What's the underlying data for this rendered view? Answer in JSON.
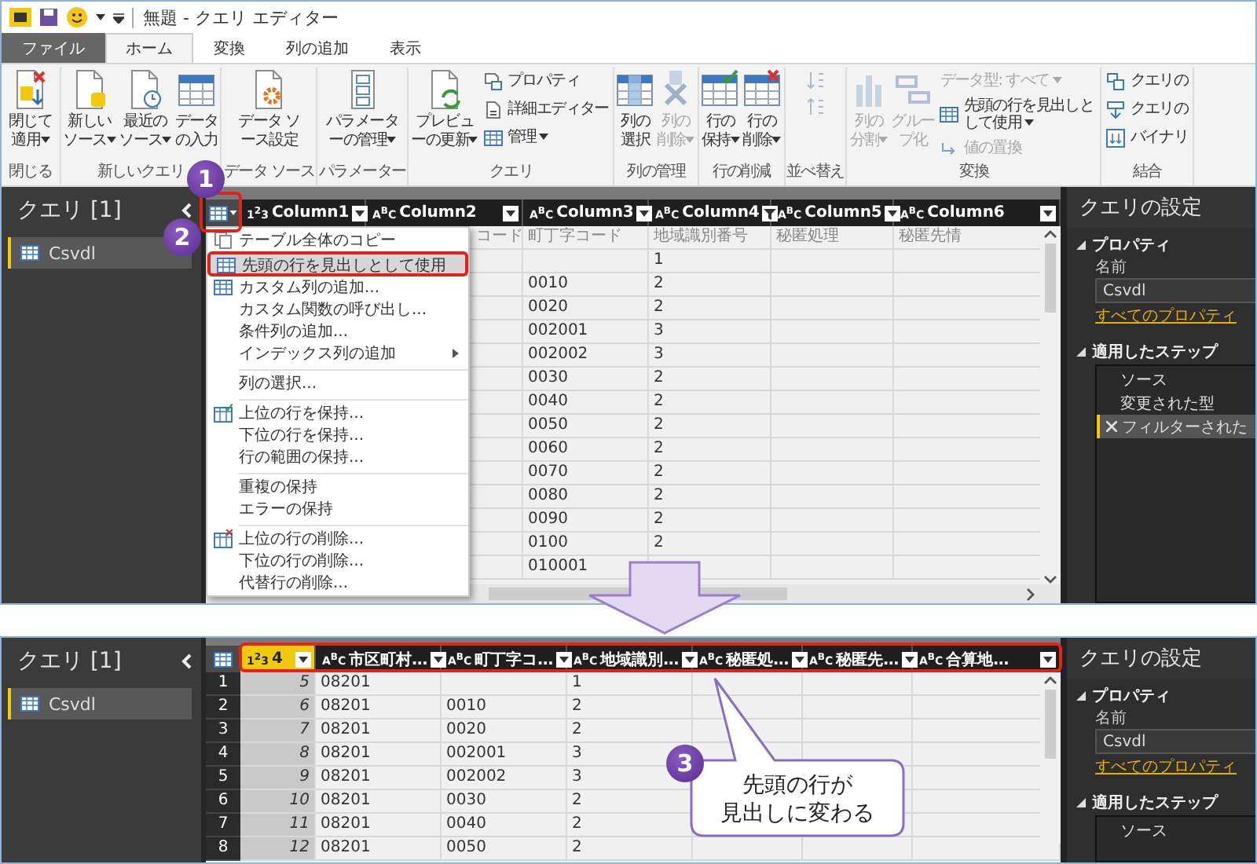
{
  "top_screenshot": {
    "title_bar": {
      "title": "無題 - クエリ エディター"
    },
    "tabs": [
      {
        "label": "ファイル",
        "kind": "file",
        "selected": false
      },
      {
        "label": "ホーム",
        "kind": "tab",
        "selected": true
      },
      {
        "label": "変換",
        "kind": "tab",
        "selected": false
      },
      {
        "label": "列の追加",
        "kind": "tab",
        "selected": false
      },
      {
        "label": "表示",
        "kind": "tab",
        "selected": false
      }
    ],
    "ribbon_groups": [
      {
        "label": "閉じる",
        "items": [
          {
            "kind": "large",
            "label": "閉じて適用",
            "dropdown": true,
            "disabled": false
          }
        ]
      },
      {
        "label": "新しいクエリ",
        "items": [
          {
            "kind": "large",
            "label": "新しいソース",
            "dropdown": true,
            "disabled": false
          },
          {
            "kind": "large",
            "label": "最近のソース",
            "dropdown": true,
            "disabled": false
          },
          {
            "kind": "large",
            "label": "データの入力",
            "dropdown": false,
            "disabled": false
          }
        ]
      },
      {
        "label": "データ ソース",
        "items": [
          {
            "kind": "large",
            "label": "データ ソース設定",
            "dropdown": false,
            "disabled": false
          }
        ]
      },
      {
        "label": "パラメーター",
        "items": [
          {
            "kind": "large",
            "label": "パラメーターの管理",
            "dropdown": true,
            "disabled": false
          }
        ]
      },
      {
        "label": "クエリ",
        "items": [
          {
            "kind": "large",
            "label": "プレビューの更新",
            "dropdown": true,
            "disabled": false
          },
          {
            "kind": "small",
            "label": "プロパティ",
            "dropdown": false,
            "disabled": false
          },
          {
            "kind": "small",
            "label": "詳細エディター",
            "dropdown": false,
            "disabled": false
          },
          {
            "kind": "small",
            "label": "管理",
            "dropdown": true,
            "disabled": false
          }
        ]
      },
      {
        "label": "列の管理",
        "items": [
          {
            "kind": "large",
            "label": "列の選択",
            "dropdown": false,
            "disabled": false
          },
          {
            "kind": "large",
            "label": "列の削除",
            "dropdown": true,
            "disabled": true
          }
        ]
      },
      {
        "label": "行の削減",
        "items": [
          {
            "kind": "large",
            "label": "行の保持",
            "dropdown": true,
            "disabled": false
          },
          {
            "kind": "large",
            "label": "行の削除",
            "dropdown": true,
            "disabled": false
          }
        ]
      },
      {
        "label": "並べ替え",
        "items": [
          {
            "kind": "icon",
            "disabled": true
          },
          {
            "kind": "icon",
            "disabled": true
          }
        ]
      },
      {
        "label": "変換",
        "items": [
          {
            "kind": "large",
            "label": "列の分割",
            "dropdown": true,
            "disabled": true
          },
          {
            "kind": "large",
            "label": "グループ化",
            "dropdown": false,
            "disabled": true
          },
          {
            "kind": "small",
            "label": "データ型: すべて",
            "dropdown": true,
            "disabled": true
          },
          {
            "kind": "small",
            "label": "先頭の行を見出しとして使用",
            "dropdown": true,
            "disabled": false
          },
          {
            "kind": "small",
            "label": "値の置換",
            "dropdown": false,
            "disabled": true
          }
        ]
      },
      {
        "label": "結合",
        "items": [
          {
            "kind": "small",
            "label": "クエリの",
            "dropdown": false,
            "disabled": false
          },
          {
            "kind": "small",
            "label": "クエリの",
            "dropdown": false,
            "disabled": false
          },
          {
            "kind": "small",
            "label": "バイナリ",
            "dropdown": false,
            "disabled": false
          }
        ]
      }
    ],
    "query_pane": {
      "title": "クエリ [1]",
      "items": [
        {
          "label": "Csvdl",
          "selected": true
        }
      ]
    },
    "grid": {
      "columns": [
        {
          "label": "Column1",
          "type": "1$^{2}$3",
          "filtered": false
        },
        {
          "label": "Column2",
          "type": "A$^{B}$C",
          "filtered": false
        },
        {
          "label": "Column3",
          "type": "A$^{B}$C",
          "filtered": false
        },
        {
          "label": "Column4",
          "type": "A$^{B}$C",
          "filtered": true
        },
        {
          "label": "Column5",
          "type": "A$^{B}$C",
          "filtered": false
        },
        {
          "label": "Column6",
          "type": "A$^{B}$C",
          "filtered": false
        }
      ],
      "rows": [
        {
          "kind": "header_text",
          "column_2": "コード",
          "column_3": "町丁字コード",
          "column_4": "地域識別番号",
          "column_5": "秘匿処理",
          "column_6": "秘匿先情"
        },
        {
          "kind": "data",
          "column_4": "1"
        },
        {
          "kind": "data",
          "column_3": "0010",
          "column_4": "2"
        },
        {
          "kind": "data",
          "column_3": "0020",
          "column_4": "2"
        },
        {
          "kind": "data",
          "column_3": "002001",
          "column_4": "3"
        },
        {
          "kind": "data",
          "column_3": "002002",
          "column_4": "3"
        },
        {
          "kind": "data",
          "column_3": "0030",
          "column_4": "2"
        },
        {
          "kind": "data",
          "column_3": "0040",
          "column_4": "2"
        },
        {
          "kind": "data",
          "column_3": "0050",
          "column_4": "2"
        },
        {
          "kind": "data",
          "column_3": "0060",
          "column_4": "2"
        },
        {
          "kind": "data",
          "column_3": "0070",
          "column_4": "2"
        },
        {
          "kind": "data",
          "column_3": "0080",
          "column_4": "2"
        },
        {
          "kind": "data",
          "column_3": "0090",
          "column_4": "2"
        },
        {
          "kind": "data",
          "column_3": "0100",
          "column_4": "2"
        },
        {
          "kind": "data",
          "column_3": "010001"
        }
      ]
    },
    "context_menu": {
      "items": [
        {
          "kind": "item",
          "label": "テーブル全体のコピー",
          "selected": false,
          "submenu": false
        },
        {
          "kind": "item",
          "label": "先頭の行を見出しとして使用",
          "selected": true,
          "submenu": false
        },
        {
          "kind": "item",
          "label": "カスタム列の追加...",
          "selected": false,
          "submenu": false
        },
        {
          "kind": "item",
          "label": "カスタム関数の呼び出し...",
          "selected": false,
          "submenu": false
        },
        {
          "kind": "item",
          "label": "条件列の追加...",
          "selected": false,
          "submenu": false
        },
        {
          "kind": "item",
          "label": "インデックス列の追加",
          "selected": false,
          "submenu": true
        },
        {
          "kind": "separator"
        },
        {
          "kind": "item",
          "label": "列の選択...",
          "selected": false,
          "submenu": false
        },
        {
          "kind": "separator"
        },
        {
          "kind": "item",
          "label": "上位の行を保持...",
          "selected": false,
          "submenu": false
        },
        {
          "kind": "item",
          "label": "下位の行を保持...",
          "selected": false,
          "submenu": false
        },
        {
          "kind": "item",
          "label": "行の範囲の保持...",
          "selected": false,
          "submenu": false
        },
        {
          "kind": "separator"
        },
        {
          "kind": "item",
          "label": "重複の保持",
          "selected": false,
          "submenu": false
        },
        {
          "kind": "item",
          "label": "エラーの保持",
          "selected": false,
          "submenu": false
        },
        {
          "kind": "separator"
        },
        {
          "kind": "item",
          "label": "上位の行の削除...",
          "selected": false,
          "submenu": false
        },
        {
          "kind": "item",
          "label": "下位の行の削除...",
          "selected": false,
          "submenu": false
        },
        {
          "kind": "item",
          "label": "代替行の削除...",
          "selected": false,
          "submenu": false
        }
      ]
    },
    "query_settings": {
      "title": "クエリの設定",
      "properties_heading": "プロパティ",
      "name_label": "名前",
      "name_value": "Csvdl",
      "all_properties_link": "すべてのプロパティ",
      "steps_heading": "適用したステップ",
      "steps": [
        {
          "label": "ソース",
          "selected": false
        },
        {
          "label": "変更された型",
          "selected": false
        },
        {
          "label": "フィルターされた",
          "selected": true
        }
      ]
    }
  },
  "bottom_screenshot": {
    "query_pane": {
      "title": "クエリ [1]",
      "items": [
        {
          "label": "Csvdl",
          "selected": true
        }
      ]
    },
    "grid": {
      "columns": [
        {
          "label": "4",
          "type": "1$^{2}$3",
          "selected": true
        },
        {
          "label": "市区町村…",
          "type": "A$^{B}$C",
          "selected": false
        },
        {
          "label": "町丁字コ…",
          "type": "A$^{B}$C",
          "selected": false
        },
        {
          "label": "地域識別…",
          "type": "A$^{B}$C",
          "selected": false
        },
        {
          "label": "秘匿処…",
          "type": "A$^{B}$C",
          "selected": false
        },
        {
          "label": "秘匿先…",
          "type": "A$^{B}$C",
          "selected": false
        },
        {
          "label": "合算地…",
          "type": "A$^{B}$C",
          "selected": false
        }
      ],
      "rows": [
        {
          "number": "1",
          "column_1": "5",
          "column_2": "08201",
          "column_4": "1"
        },
        {
          "number": "2",
          "column_1": "6",
          "column_2": "08201",
          "column_3": "0010",
          "column_4": "2"
        },
        {
          "number": "3",
          "column_1": "7",
          "column_2": "08201",
          "column_3": "0020",
          "column_4": "2"
        },
        {
          "number": "4",
          "column_1": "8",
          "column_2": "08201",
          "column_3": "002001",
          "column_4": "3"
        },
        {
          "number": "5",
          "column_1": "9",
          "column_2": "08201",
          "column_3": "002002",
          "column_4": "3"
        },
        {
          "number": "6",
          "column_1": "10",
          "column_2": "08201",
          "column_3": "0030",
          "column_4": "2"
        },
        {
          "number": "7",
          "column_1": "11",
          "column_2": "08201",
          "column_3": "0040",
          "column_4": "2"
        },
        {
          "number": "8",
          "column_1": "12",
          "column_2": "08201",
          "column_3": "0050",
          "column_4": "2"
        }
      ]
    },
    "query_settings": {
      "title": "クエリの設定",
      "properties_heading": "プロパティ",
      "name_label": "名前",
      "name_value": "Csvdl",
      "all_properties_link": "すべてのプロパティ",
      "steps_heading": "適用したステップ",
      "steps": [
        {
          "label": "ソース",
          "selected": false
        }
      ]
    }
  },
  "annotations": {
    "badges": [
      "1",
      "2",
      "3"
    ],
    "callout": {
      "lines": [
        "先頭の行が",
        "見出しに変わる"
      ]
    }
  }
}
